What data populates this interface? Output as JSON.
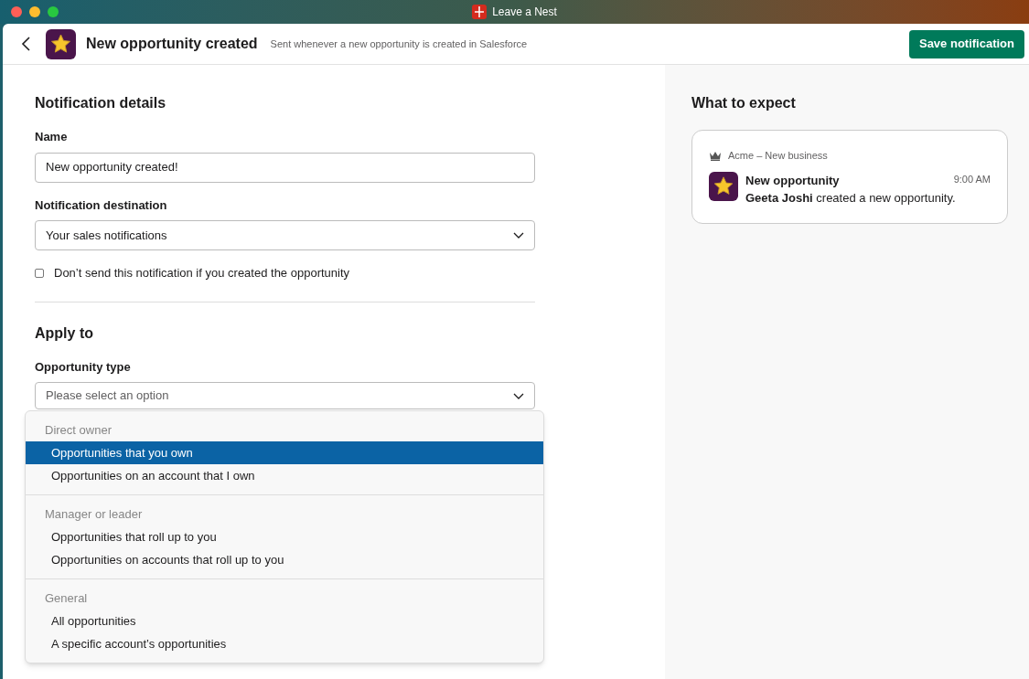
{
  "window": {
    "title": "Leave a Nest"
  },
  "header": {
    "title": "New opportunity created",
    "subtitle": "Sent whenever a new opportunity is created in Salesforce",
    "save_button": "Save notification"
  },
  "details": {
    "heading": "Notification details",
    "name_label": "Name",
    "name_value": "New opportunity created!",
    "destination_label": "Notification destination",
    "destination_value": "Your sales notifications",
    "checkbox": {
      "label": "Don’t send this notification if you created the opportunity",
      "checked": false
    }
  },
  "apply_to": {
    "heading": "Apply to",
    "type_label": "Opportunity type",
    "type_placeholder": "Please select an option"
  },
  "dropdown": {
    "groups": [
      {
        "label": "Direct owner",
        "options": [
          {
            "label": "Opportunities that you own",
            "selected": true
          },
          {
            "label": "Opportunities on an account that I own",
            "selected": false
          }
        ]
      },
      {
        "label": "Manager or leader",
        "options": [
          {
            "label": "Opportunities that roll up to you",
            "selected": false
          },
          {
            "label": "Opportunities on accounts that roll up to you",
            "selected": false
          }
        ]
      },
      {
        "label": "General",
        "options": [
          {
            "label": "All opportunities",
            "selected": false
          },
          {
            "label": "A specific account’s opportunities",
            "selected": false
          }
        ]
      }
    ]
  },
  "preview": {
    "heading": "What to expect",
    "workspace": "Acme – New business",
    "title": "New opportunity",
    "time": "9:00 AM",
    "message": "**Geeta Joshi** created a new opportunity."
  }
}
